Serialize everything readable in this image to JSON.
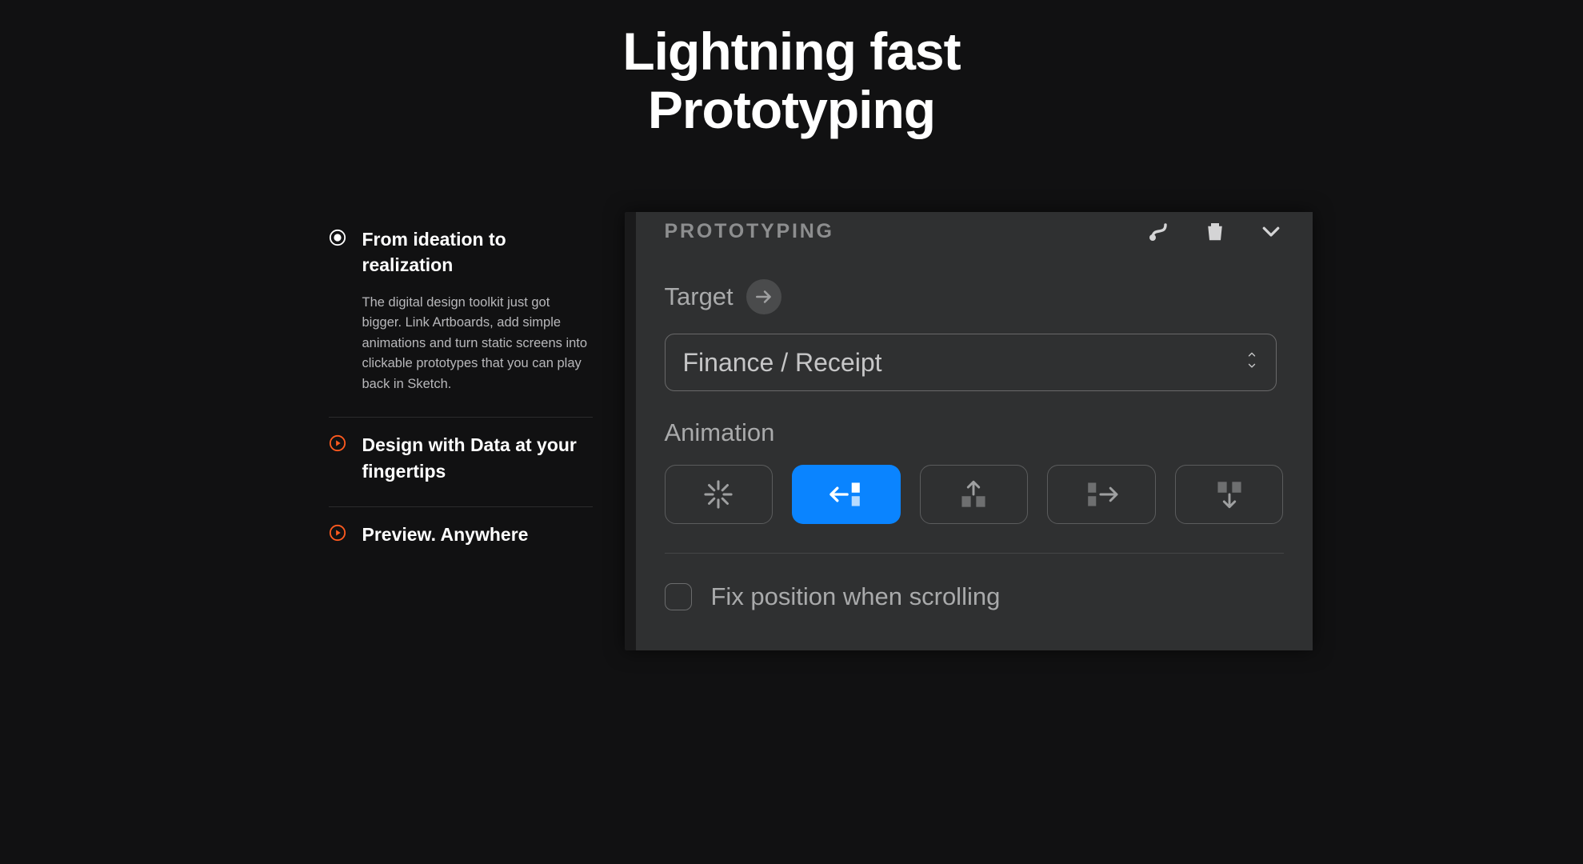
{
  "heading": {
    "line1": "Lightning fast",
    "line2": "Prototyping"
  },
  "features": [
    {
      "title": "From ideation to realization",
      "desc": "The digital design toolkit just got bigger. Link Artboards, add simple animations and turn static screens into clickable prototypes that you can play back in Sketch.",
      "active": true
    },
    {
      "title": "Design with Data at your fingertips",
      "desc": "",
      "active": false
    },
    {
      "title": "Preview. Anywhere",
      "desc": "",
      "active": false
    }
  ],
  "panel": {
    "title": "PROTOTYPING",
    "target_label": "Target",
    "target_value": "Finance / Receipt",
    "animation_label": "Animation",
    "animations": [
      {
        "name": "no-animation",
        "active": false
      },
      {
        "name": "slide-left",
        "active": true
      },
      {
        "name": "slide-up",
        "active": false
      },
      {
        "name": "slide-right",
        "active": false
      },
      {
        "name": "slide-down",
        "active": false
      }
    ],
    "fix_label": "Fix position when scrolling",
    "fix_checked": false
  },
  "colors": {
    "accent": "#ff5a1f",
    "primary": "#0a84ff"
  }
}
